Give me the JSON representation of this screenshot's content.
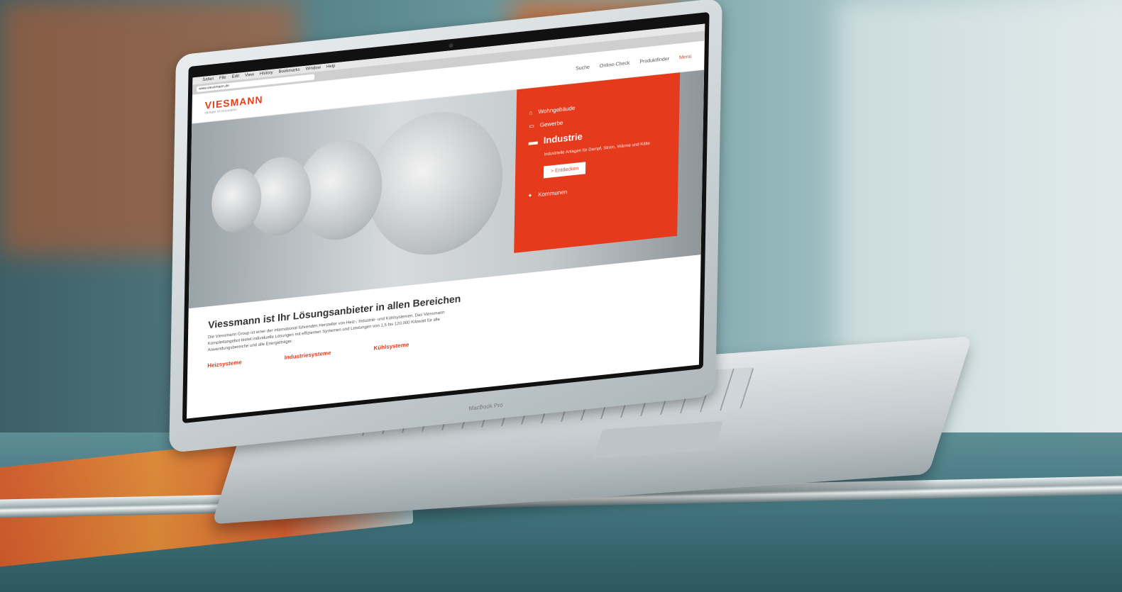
{
  "browser": {
    "app_name": "Safari",
    "menu_items": [
      "Safari",
      "File",
      "Edit",
      "View",
      "History",
      "Bookmarks",
      "Window",
      "Help"
    ],
    "url": "www.viessmann.de"
  },
  "site": {
    "logo": "VIESMANN",
    "tagline": "climate of innovation",
    "nav": {
      "search": "Suche",
      "online_check": "Online-Check",
      "product_finder": "Produktfinder",
      "menu": "Menü"
    },
    "panel": {
      "item1": "Wohngebäude",
      "item2": "Gewerbe",
      "active_title": "Industrie",
      "active_desc": "Industrielle Anlagen für Dampf, Strom, Wärme und Kälte",
      "button": "> Entdecken",
      "item4": "Kommunen"
    },
    "headline": "Viessmann ist Ihr Lösungsanbieter in allen Bereichen",
    "intro": "Die Viessmann Group ist einer der international führenden Hersteller von Heiz-, Industrie- und Kühlsystemen. Das Viessmann Komplettangebot bietet individuelle Lösungen mit effizienten Systemen und Leistungen von 1,5 bis 120.000 Kilowatt für alle Anwendungsbereiche und alle Energieträger.",
    "columns": [
      "Heizsysteme",
      "Industriesysteme",
      "Kühlsysteme"
    ]
  },
  "laptop": {
    "brand_label": "MacBook Pro"
  }
}
